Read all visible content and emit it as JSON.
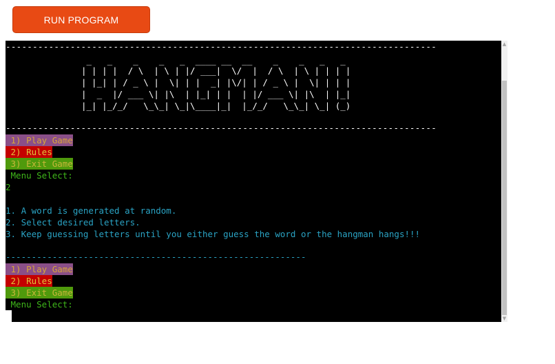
{
  "toolbar": {
    "run_label": "RUN PROGRAM"
  },
  "terminal": {
    "rule_top": "--------------------------------------------------------------------------------",
    "ascii_banner": [
      " _   _    _    _   _  ____ __  __    _    _   _   _ ",
      "| | | |  / \\  | \\ | |/ ___|  \\/  |  / \\  | \\ | | | |",
      "| |_| | / _ \\ |  \\| | |  _| |\\/| | / _ \\ |  \\| | | |",
      "|  _  |/ ___ \\| |\\  | |_| | |  | |/ ___ \\| |\\  | |_|",
      "|_| |_/_/   \\_\\_| \\_|\\____|_|  |_/_/   \\_\\_| \\_| (_)"
    ],
    "rule_mid": "--------------------------------------------------------------------------------",
    "menu1": {
      "play": " 1) Play Game",
      "rules": " 2) Rules",
      "exit": " 3) Exit Game",
      "prompt": " Menu Select:",
      "input": "2"
    },
    "rules_lines": [
      "1. A word is generated at random.",
      "2. Select desired letters.",
      "3. Keep guessing letters until you either guess the word or the hangman hangs!!!"
    ],
    "rule_short": "----------------------------------------------------------",
    "menu2": {
      "play": " 1) Play Game",
      "rules": " 2) Rules",
      "exit": " 3) Exit Game",
      "prompt": " Menu Select:"
    }
  },
  "colors": {
    "button": "#e84a14",
    "play_bg": "#8a4f88",
    "rules_bg": "#c40000",
    "exit_bg": "#4f9a0c",
    "prompt": "#3fb81a",
    "info": "#2aa3c4"
  },
  "icons": {
    "scroll_up": "triangle-up-icon",
    "scroll_down": "triangle-down-icon"
  }
}
